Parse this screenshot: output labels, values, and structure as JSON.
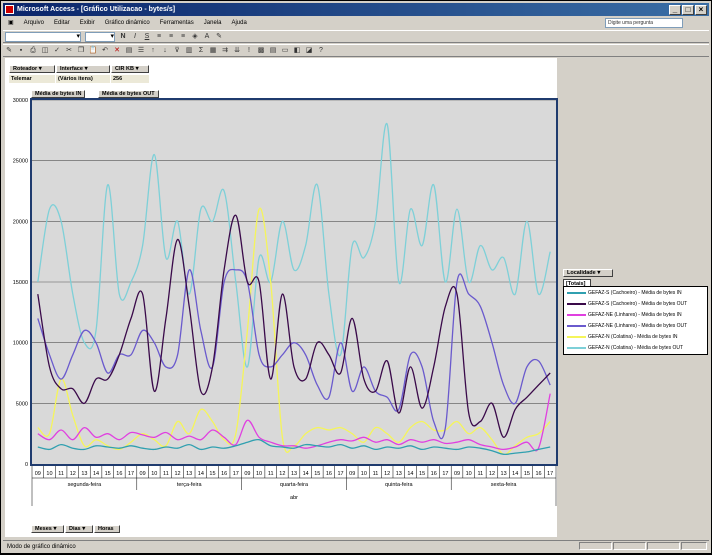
{
  "window": {
    "title": "Microsoft Access - [Gráfico Utilizacao - bytes/s]",
    "ask_placeholder": "Digite uma pergunta"
  },
  "menu": [
    "Arquivo",
    "Editar",
    "Exibir",
    "Gráfico dinâmico",
    "Ferramentas",
    "Janela",
    "Ajuda"
  ],
  "filters": [
    {
      "label": "Roteador",
      "value": "Telemar"
    },
    {
      "label": "Interface",
      "value": "(Vários itens)"
    },
    {
      "label": "CIR KB",
      "value": "256"
    }
  ],
  "data_fields": [
    "Média de bytes IN",
    "Média de bytes OUT"
  ],
  "legend_field": "Localidade",
  "legend_total": "[Totais]",
  "category_fields": [
    "Meses",
    "Dias",
    "Horas"
  ],
  "axis_title": "abr",
  "status": "Modo de gráfico dinâmico",
  "chart_data": {
    "type": "line",
    "ylim": [
      0,
      30000
    ],
    "yticks": [
      "0",
      "5000",
      "10000",
      "15000",
      "20000",
      "25000",
      "30000"
    ],
    "hours": [
      "09",
      "10",
      "11",
      "12",
      "13",
      "14",
      "15",
      "16",
      "17"
    ],
    "days": [
      "segunda-feira",
      "terça-feira",
      "quarta-feira",
      "quinta-feira",
      "sexta-feira"
    ],
    "month": "abr",
    "grid": true,
    "legend_position": "right",
    "series": [
      {
        "name": "GEFAZ-S (Cachoeiro) - Média de bytes IN",
        "color": "#30a0b0",
        "values": [
          1400,
          1200,
          1600,
          1300,
          1200,
          1500,
          1400,
          1300,
          1500,
          1300,
          1200,
          1400,
          1300,
          1600,
          1200,
          1400,
          1300,
          1500,
          1800,
          2000,
          1500,
          1400,
          1300,
          1600,
          1500,
          1400,
          1600,
          1300,
          1500,
          1200,
          1400,
          1300,
          1500,
          1200,
          1400,
          1300,
          1200,
          1400,
          1300,
          1100,
          800,
          900,
          1000,
          1200,
          1400
        ]
      },
      {
        "name": "GEFAZ-S (Cachoeiro) - Média de bytes OUT",
        "color": "#3a0a4a",
        "values": [
          14000,
          8000,
          6200,
          6200,
          5000,
          7000,
          7000,
          9000,
          12000,
          14000,
          6000,
          12000,
          18500,
          13000,
          6000,
          8000,
          16000,
          20500,
          15000,
          15000,
          7000,
          14000,
          8000,
          7000,
          10000,
          9000,
          7500,
          12000,
          7000,
          6000,
          8500,
          4200,
          8000,
          4600,
          8000,
          13000,
          14000,
          4200,
          3500,
          5000,
          2200,
          4500,
          5500,
          6500,
          7500
        ]
      },
      {
        "name": "GEFAZ-NE (Linhares) - Média de bytes IN",
        "color": "#e040e0",
        "values": [
          2500,
          2000,
          2800,
          2000,
          3000,
          2200,
          2500,
          2000,
          2600,
          2400,
          2200,
          2600,
          2000,
          2300,
          2000,
          2800,
          2200,
          1600,
          3600,
          2200,
          1800,
          1500,
          1500,
          1300,
          1500,
          1800,
          2000,
          1900,
          2200,
          1800,
          2000,
          1600,
          2000,
          1800,
          2000,
          1700,
          1800,
          2000,
          1600,
          1400,
          1200,
          1400,
          1800,
          1300,
          5800
        ]
      },
      {
        "name": "GEFAZ-NE (Linhares) - Média de bytes OUT",
        "color": "#6a5acd",
        "values": [
          12000,
          9000,
          7000,
          9000,
          11000,
          10000,
          7500,
          9000,
          9000,
          11000,
          10000,
          8000,
          9000,
          16000,
          11000,
          8000,
          15000,
          16000,
          15000,
          9000,
          8000,
          9000,
          10000,
          9000,
          6500,
          5500,
          10000,
          6000,
          8000,
          6000,
          5500,
          4500,
          9000,
          8000,
          3500,
          3000,
          15000,
          14000,
          13000,
          10000,
          6500,
          5000,
          8000,
          8500,
          6500
        ]
      },
      {
        "name": "GEFAZ-N (Colatina) - Média de bytes IN",
        "color": "#f5f55a",
        "values": [
          3000,
          2500,
          7000,
          4000,
          1500,
          2000,
          1500,
          1200,
          1800,
          2500,
          2000,
          1500,
          3500,
          2500,
          4500,
          3500,
          2000,
          2500,
          11000,
          21000,
          15000,
          2200,
          1500,
          2500,
          3000,
          2800,
          3000,
          2500,
          1800,
          3000,
          2500,
          1800,
          3000,
          3500,
          2800,
          2800,
          3500,
          2500,
          3000,
          2000,
          800,
          1500,
          2200,
          2500,
          3500
        ]
      },
      {
        "name": "GEFAZ-N (Colatina) - Média de bytes OUT",
        "color": "#7ed0d8",
        "values": [
          15000,
          21000,
          20000,
          14000,
          10000,
          11000,
          23000,
          14000,
          15000,
          18000,
          25500,
          17000,
          20000,
          14000,
          21000,
          20000,
          22500,
          15000,
          8000,
          17000,
          15000,
          20000,
          16000,
          18000,
          23000,
          14000,
          9000,
          18000,
          17000,
          20000,
          28000,
          15000,
          21000,
          18000,
          23000,
          15000,
          21000,
          15000,
          18000,
          16000,
          17000,
          14000,
          20000,
          14000,
          17500
        ]
      }
    ]
  }
}
